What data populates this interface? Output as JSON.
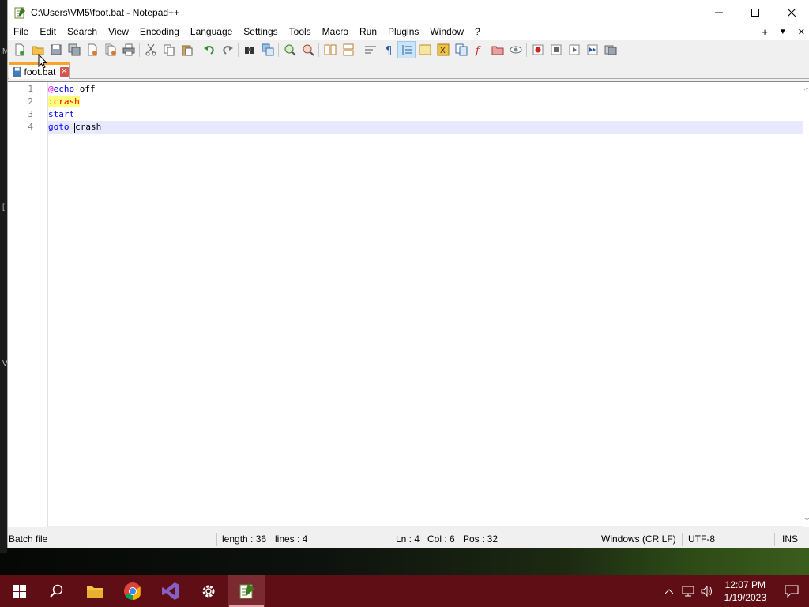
{
  "window": {
    "title": "C:\\Users\\VM5\\foot.bat - Notepad++"
  },
  "menu": [
    "File",
    "Edit",
    "Search",
    "View",
    "Encoding",
    "Language",
    "Settings",
    "Tools",
    "Macro",
    "Run",
    "Plugins",
    "Window",
    "?"
  ],
  "menu_right": {
    "add": "+",
    "dropdown": "▼",
    "close": "✕"
  },
  "tab": {
    "label": "foot.bat"
  },
  "editor": {
    "lines": [
      {
        "num": "1",
        "tokens": [
          {
            "t": "@",
            "c": "at"
          },
          {
            "t": "echo",
            "c": "kw"
          },
          {
            "t": " off",
            "c": "plain"
          }
        ]
      },
      {
        "num": "2",
        "tokens": [
          {
            "t": ":crash",
            "c": "label"
          }
        ]
      },
      {
        "num": "3",
        "tokens": [
          {
            "t": "start",
            "c": "kw"
          }
        ]
      },
      {
        "num": "4",
        "tokens": [
          {
            "t": "goto",
            "c": "kw"
          },
          {
            "t": " ",
            "c": "plain"
          },
          {
            "t": "|",
            "c": "caret"
          },
          {
            "t": "crash",
            "c": "plain"
          }
        ]
      }
    ],
    "current_line": 4
  },
  "status": {
    "lang": "Batch file",
    "length": "length : 36",
    "lines": "lines : 4",
    "ln": "Ln : 4",
    "col": "Col : 6",
    "pos": "Pos : 32",
    "eol": "Windows (CR LF)",
    "encoding": "UTF-8",
    "mode": "INS"
  },
  "taskbar": {
    "time": "12:07 PM",
    "date": "1/19/2023"
  },
  "colors": {
    "taskbar": "#5e0e14",
    "tab_accent": "#f7a52a",
    "keyword": "#0000ff",
    "label_bg": "#ffff80"
  }
}
